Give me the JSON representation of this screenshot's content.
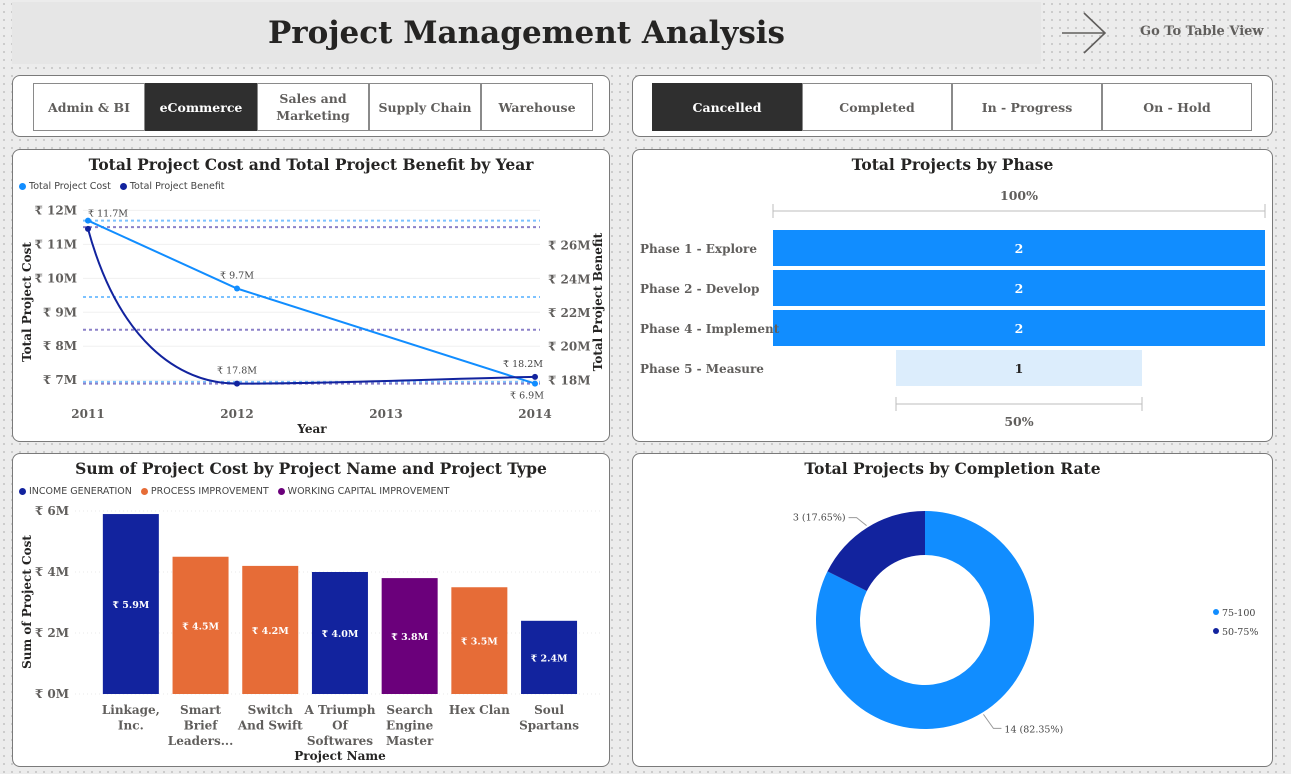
{
  "header": {
    "title": "Project Management Analysis",
    "nav_label": "Go To Table View",
    "nav_icon": "arrow-right-icon"
  },
  "department_slicer": {
    "items": [
      {
        "label": "Admin & BI",
        "selected": false
      },
      {
        "label": "eCommerce",
        "selected": true
      },
      {
        "label": "Sales and Marketing",
        "selected": false
      },
      {
        "label": "Supply Chain",
        "selected": false
      },
      {
        "label": "Warehouse",
        "selected": false
      }
    ]
  },
  "status_slicer": {
    "items": [
      {
        "label": "Cancelled",
        "selected": true
      },
      {
        "label": "Completed",
        "selected": false
      },
      {
        "label": "In - Progress",
        "selected": false
      },
      {
        "label": "On - Hold",
        "selected": false
      }
    ]
  },
  "colors": {
    "cost_line": "#118dff",
    "benefit_line": "#12239e",
    "income_generation": "#12239e",
    "process_improvement": "#e66c37",
    "working_capital_improvement": "#6b007b",
    "phase_bar": "#118dff",
    "phase_bar_light": "#dcedfc",
    "donut_75_100": "#118dff",
    "donut_50_75": "#12239e",
    "active_slicer": "#2f2f2f"
  },
  "charts": {
    "cost_benefit": {
      "title": "Total Project Cost and Total Project Benefit by Year",
      "legend": [
        "Total Project Cost",
        "Total Project Benefit"
      ],
      "xlabel": "Year",
      "ylabel_left": "Total Project Cost",
      "ylabel_right": "Total Project Benefit"
    },
    "phase": {
      "title": "Total Projects by Phase",
      "top_pct": "100%",
      "bottom_pct": "50%"
    },
    "project_cost": {
      "title": "Sum of Project Cost by Project Name and Project Type",
      "xlabel": "Project Name",
      "ylabel": "Sum of Project Cost"
    },
    "completion": {
      "title": "Total Projects by Completion Rate",
      "legend": [
        "75-100",
        "50-75%"
      ]
    }
  },
  "chart_data": [
    {
      "type": "line",
      "title": "Total Project Cost and Total Project Benefit by Year",
      "xlabel": "Year",
      "ylabel": "Total Project Cost",
      "y2label": "Total Project Benefit",
      "x": [
        2011,
        2012,
        2014
      ],
      "x_ticks": [
        "2011",
        "2012",
        "2013",
        "2014"
      ],
      "series": [
        {
          "name": "Total Project Cost",
          "axis": "left",
          "values": [
            11.7,
            9.7,
            6.9
          ],
          "labels": [
            "₹ 11.7M",
            "₹ 9.7M",
            "₹ 6.9M"
          ]
        },
        {
          "name": "Total Project Benefit",
          "axis": "right",
          "values": [
            27.0,
            17.8,
            18.2
          ],
          "labels": [
            "",
            "₹ 17.8M",
            "₹ 18.2M"
          ]
        }
      ],
      "ylim": [
        6.8,
        12.1
      ],
      "y_ticks": [
        "₹ 12M",
        "₹ 11M",
        "₹ 10M",
        "₹ 9M",
        "₹ 8M",
        "₹ 7M"
      ],
      "y_tick_values": [
        12,
        11,
        10,
        9,
        8,
        7
      ],
      "y2lim": [
        17.6,
        28.3
      ],
      "y2_ticks": [
        "₹ 26M",
        "₹ 24M",
        "₹ 22M",
        "₹ 20M",
        "₹ 18M"
      ],
      "y2_tick_values": [
        26,
        24,
        22,
        20,
        18
      ],
      "reference_lines": {
        "cost": [
          11.7,
          9.45,
          6.95
        ],
        "benefit": [
          27.1,
          21.0,
          17.8
        ]
      }
    },
    {
      "type": "bar",
      "orientation": "horizontal",
      "title": "Total Projects by Phase",
      "categories": [
        "Phase 1 - Explore",
        "Phase 2 - Develop",
        "Phase 4 - Implement",
        "Phase 5 - Measure"
      ],
      "values": [
        2,
        2,
        2,
        1
      ],
      "top_label": "100%",
      "bottom_label": "50%"
    },
    {
      "type": "bar",
      "title": "Sum of Project Cost by Project Name and Project Type",
      "xlabel": "Project Name",
      "ylabel": "Sum of Project Cost",
      "categories": [
        "Linkage, Inc.",
        "Smart Brief Leaders...",
        "Switch And Swift",
        "A Triumph Of Softwares",
        "Search Engine Master",
        "Hex Clan",
        "Soul Spartans"
      ],
      "values": [
        5.9,
        4.5,
        4.2,
        4.0,
        3.8,
        3.5,
        2.4
      ],
      "value_labels": [
        "₹ 5.9M",
        "₹ 4.5M",
        "₹ 4.2M",
        "₹ 4.0M",
        "₹ 3.8M",
        "₹ 3.5M",
        "₹ 2.4M"
      ],
      "project_types": [
        "INCOME GENERATION",
        "PROCESS IMPROVEMENT",
        "PROCESS IMPROVEMENT",
        "INCOME GENERATION",
        "WORKING CAPITAL IMPROVEMENT",
        "PROCESS IMPROVEMENT",
        "INCOME GENERATION"
      ],
      "legend": [
        "INCOME GENERATION",
        "PROCESS IMPROVEMENT",
        "WORKING CAPITAL IMPROVEMENT"
      ],
      "ylim": [
        0,
        6
      ],
      "y_ticks": [
        "₹ 6M",
        "₹ 4M",
        "₹ 2M",
        "₹ 0M"
      ],
      "y_tick_values": [
        6,
        4,
        2,
        0
      ]
    },
    {
      "type": "pie",
      "variant": "donut",
      "title": "Total Projects by Completion Rate",
      "categories": [
        "75-100",
        "50-75%"
      ],
      "values": [
        14,
        3
      ],
      "labels": [
        "14 (82.35%)",
        "3 (17.65%)"
      ]
    }
  ]
}
